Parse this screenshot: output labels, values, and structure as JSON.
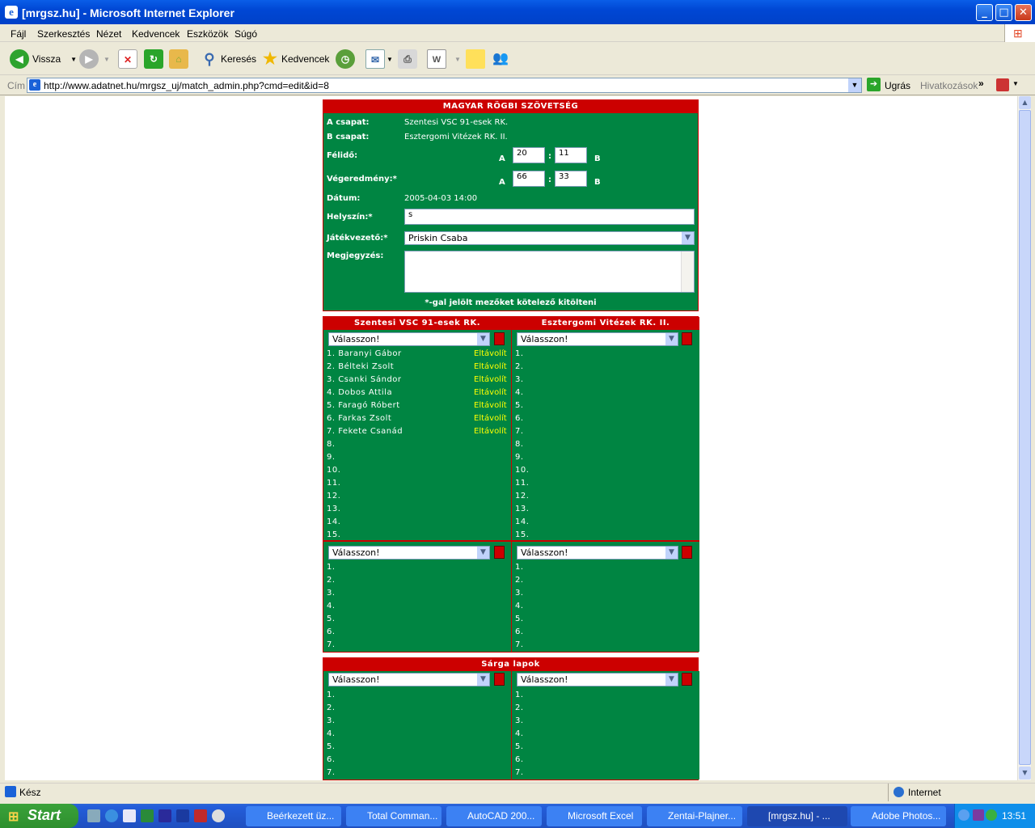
{
  "window": {
    "title": "[mrgsz.hu] - Microsoft Internet Explorer"
  },
  "menu": [
    "Fájl",
    "Szerkesztés",
    "Nézet",
    "Kedvencek",
    "Eszközök",
    "Súgó"
  ],
  "toolbar": {
    "back": "Vissza",
    "search": "Keresés",
    "favorites": "Kedvencek"
  },
  "address": {
    "label": "Cím",
    "url": "http://www.adatnet.hu/mrgsz_uj/match_admin.php?cmd=edit&id=8",
    "go": "Ugrás",
    "links": "Hivatkozások"
  },
  "form": {
    "header": "MAGYAR RÖGBI SZÖVETSÉG",
    "team_a_label": "A csapat:",
    "team_a": "Szentesi VSC 91-esek RK.",
    "team_b_label": "B csapat:",
    "team_b": "Esztergomi Vitézek RK. II.",
    "halftime_label": "Félidő:",
    "halftime_a": "20",
    "halftime_b": "11",
    "final_label": "Végeredmény:*",
    "final_a": "66",
    "final_b": "33",
    "a": "A",
    "b": "B",
    "colon": ":",
    "date_label": "Dátum:",
    "date": "2005-04-03 14:00",
    "venue_label": "Helyszín:*",
    "venue": "s",
    "referee_label": "Játékvezető:*",
    "referee": "Priskin Csaba",
    "note_label": "Megjegyzés:",
    "required_note": "*-gal jelölt mezőket kötelező kitölteni"
  },
  "teams": {
    "left_header": "Szentesi VSC 91-esek RK.",
    "right_header": "Esztergomi Vitézek RK. II.",
    "choose": "Válasszon!",
    "remove": "Eltávolít",
    "left_players": [
      "1. Baranyi Gábor",
      "2. Bélteki Zsolt",
      "3. Csanki Sándor",
      "4. Dobos Attila",
      "5. Faragó Róbert",
      "6. Farkas Zsolt",
      "7. Fekete Csanád",
      "8.",
      "9.",
      "10.",
      "11.",
      "12.",
      "13.",
      "14.",
      "15."
    ],
    "right_players": [
      "1.",
      "2.",
      "3.",
      "4.",
      "5.",
      "6.",
      "7.",
      "8.",
      "9.",
      "10.",
      "11.",
      "12.",
      "13.",
      "14.",
      "15."
    ],
    "subs": [
      "1.",
      "2.",
      "3.",
      "4.",
      "5.",
      "6.",
      "7."
    ]
  },
  "yellow": {
    "header": "Sárga lapok",
    "rows": [
      "1.",
      "2.",
      "3.",
      "4.",
      "5.",
      "6.",
      "7."
    ]
  },
  "status": {
    "left": "Kész",
    "zone": "Internet"
  },
  "taskbar": {
    "start": "Start",
    "tasks": [
      "Beérkezett üz...",
      "Total Comman...",
      "AutoCAD 200...",
      "Microsoft Excel",
      "Zentai-Plajner...",
      "[mrgsz.hu] - ...",
      "Adobe Photos..."
    ],
    "clock": "13:51"
  },
  "colors": {
    "green": "#008542",
    "red": "#cc0000",
    "yellow": "#ffff00"
  }
}
